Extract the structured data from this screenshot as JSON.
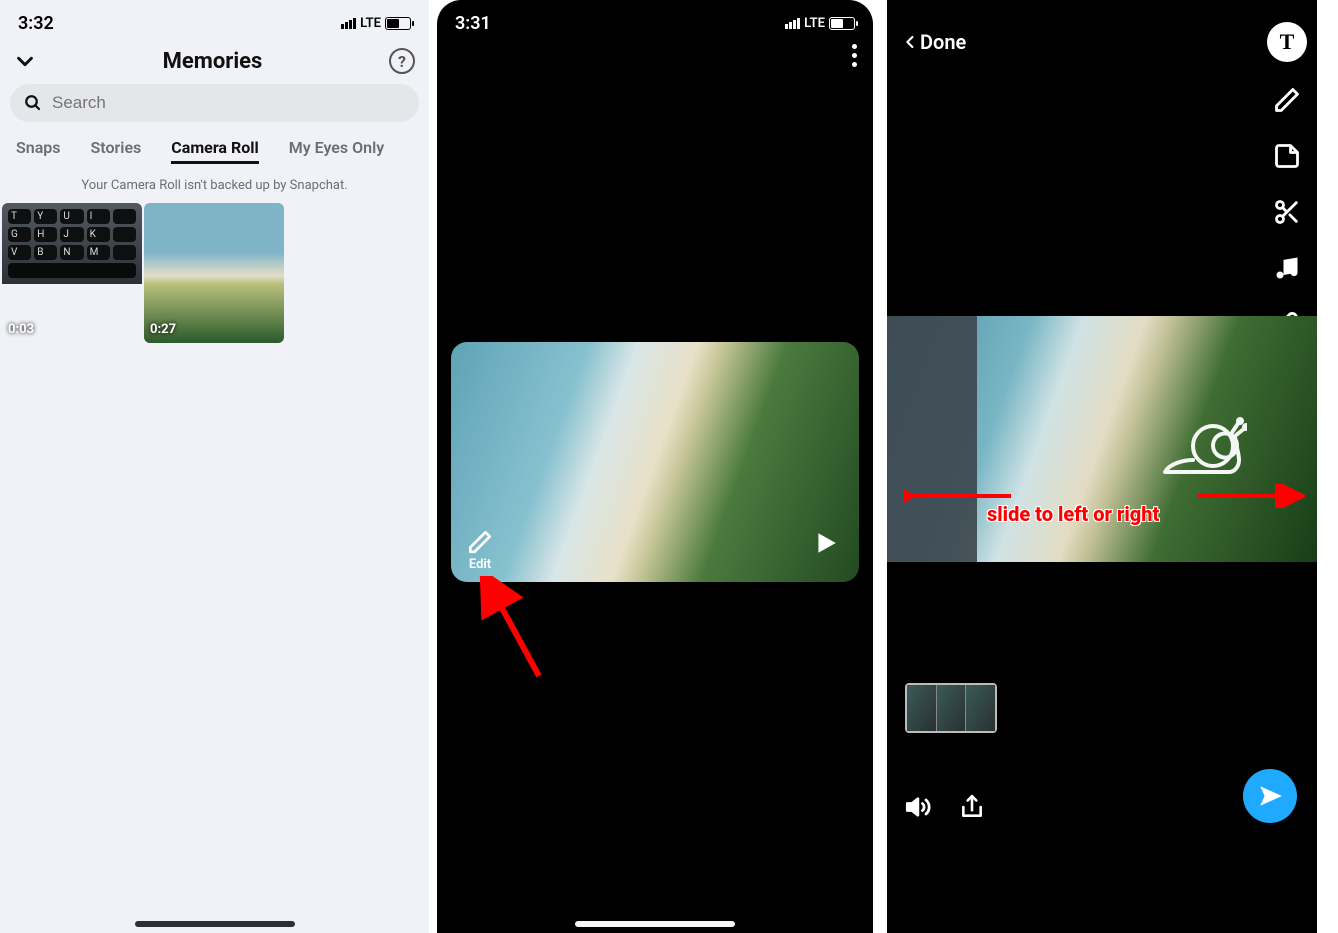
{
  "phone1": {
    "time": "3:32",
    "network": "LTE",
    "title": "Memories",
    "search_placeholder": "Search",
    "tabs": {
      "snaps": "Snaps",
      "stories": "Stories",
      "camera_roll": "Camera Roll",
      "my_eyes": "My Eyes Only"
    },
    "backup_note": "Your Camera Roll isn't backed up by Snapchat.",
    "thumbs": [
      {
        "duration": "0:03",
        "kind": "keyboard"
      },
      {
        "duration": "0:27",
        "kind": "beach"
      }
    ]
  },
  "phone2": {
    "time": "3:31",
    "network": "LTE",
    "edit_label": "Edit"
  },
  "phone3": {
    "done_label": "Done",
    "annotation": "slide to left or right"
  }
}
